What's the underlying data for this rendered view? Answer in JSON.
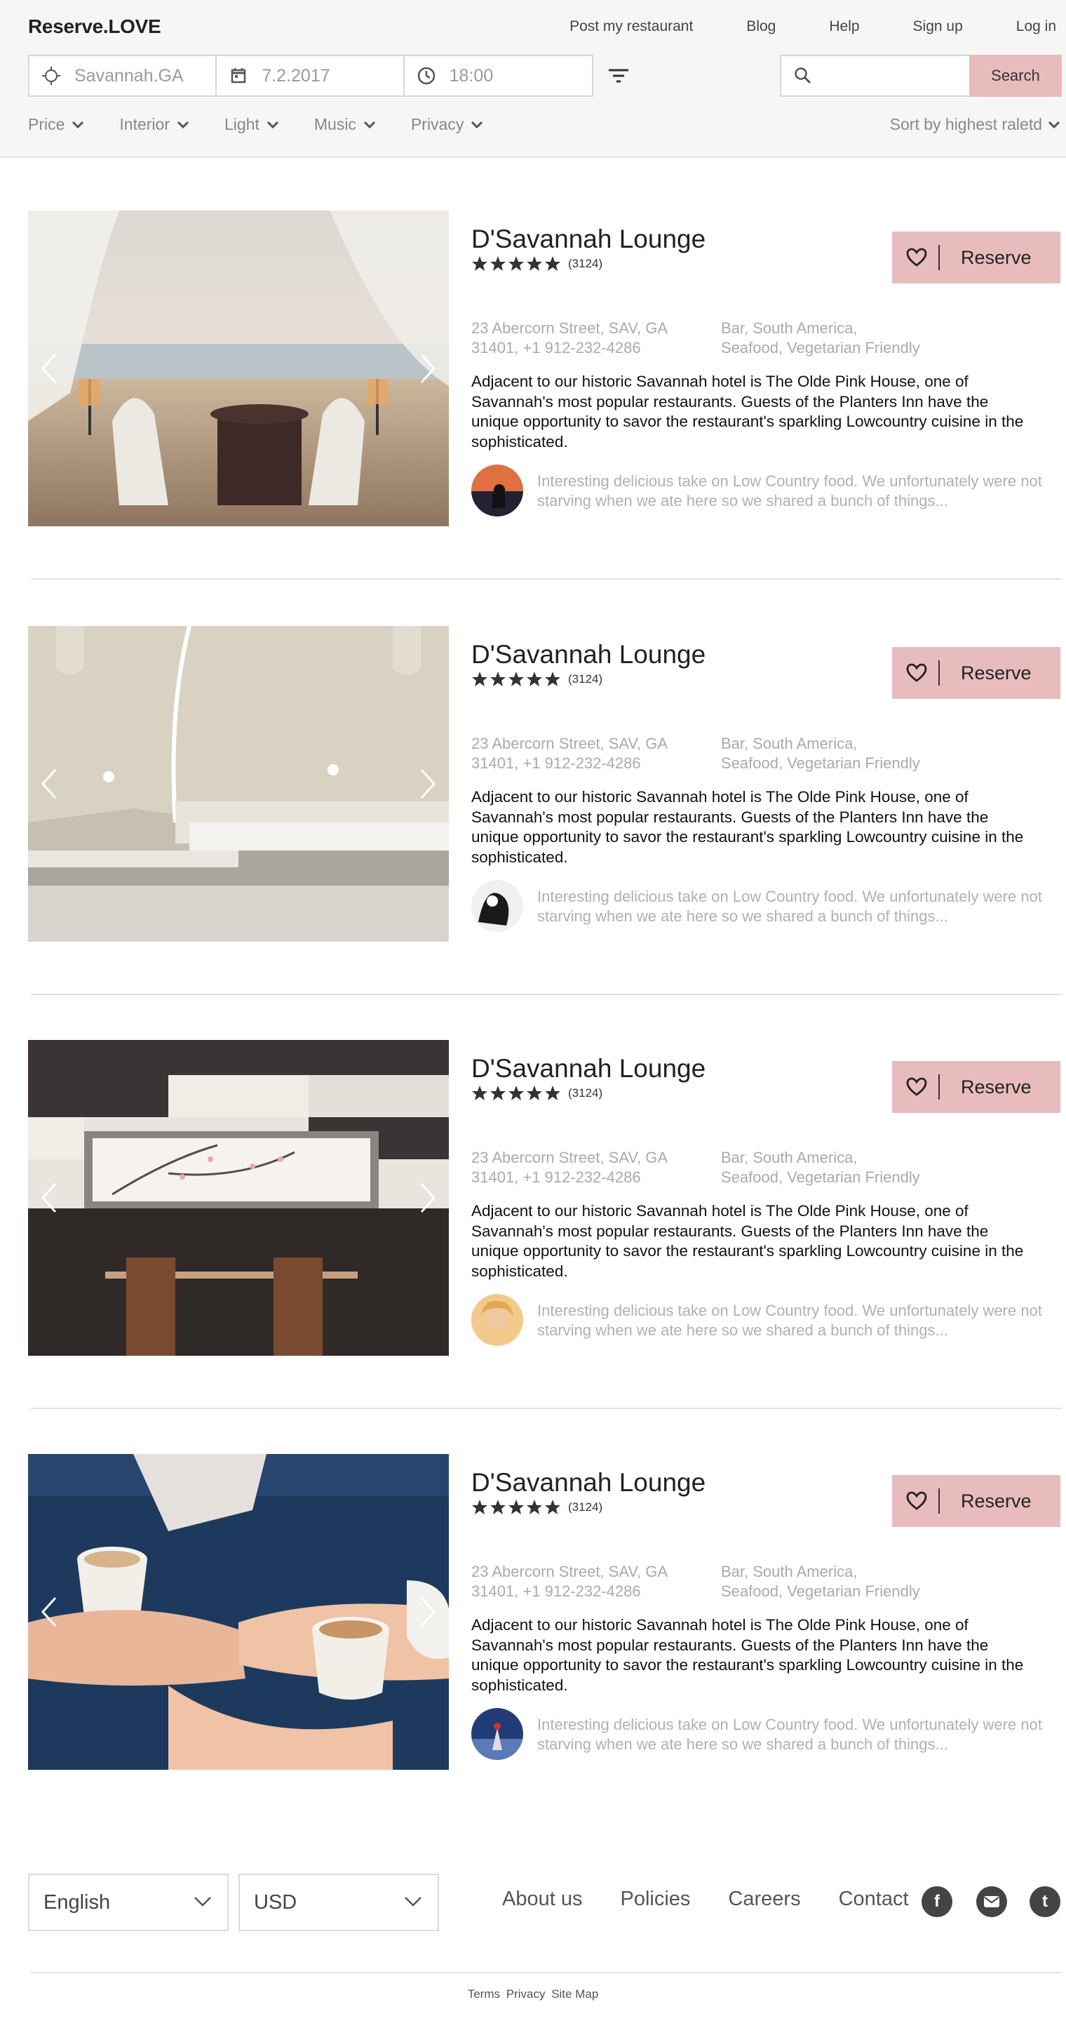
{
  "header": {
    "logo": "Reserve.LOVE",
    "nav": [
      "Post my restaurant",
      "Blog",
      "Help",
      "Sign up",
      "Log in"
    ],
    "location": "Savannah.GA",
    "date": "7.2.2017",
    "time": "18:00",
    "search_placeholder": "",
    "search_button": "Search",
    "filters": [
      "Price",
      "Interior",
      "Light",
      "Music",
      "Privacy"
    ],
    "sort": "Sort by highest raletd"
  },
  "listings": [
    {
      "name": "D'Savannah Lounge",
      "rating": 5,
      "review_count": "(3124)",
      "reserve_label": "Reserve",
      "address_line1": "23 Abercorn Street, SAV, GA",
      "address_line2": "31401, +1 912-232-4286",
      "cuisine_line1": "Bar, South America,",
      "cuisine_line2": "Seafood, Vegetarian Friendly",
      "description": "Adjacent to our historic Savannah hotel is The Olde Pink House, one of Savannah's most popular restaurants. Guests of the Planters Inn have the unique opportunity to savor the restaurant's sparkling Lowcountry cuisine in the sophisticated.",
      "review": "Interesting delicious take on Low Country food. We unfortunately were not starving when we ate here so we shared a bunch of things..."
    },
    {
      "name": "D'Savannah Lounge",
      "rating": 5,
      "review_count": "(3124)",
      "reserve_label": "Reserve",
      "address_line1": "23 Abercorn Street, SAV, GA",
      "address_line2": "31401, +1 912-232-4286",
      "cuisine_line1": "Bar, South America,",
      "cuisine_line2": "Seafood, Vegetarian Friendly",
      "description": "Adjacent to our historic Savannah hotel is The Olde Pink House, one of Savannah's most popular restaurants. Guests of the Planters Inn have the unique opportunity to savor the restaurant's sparkling Lowcountry cuisine in the sophisticated.",
      "review": "Interesting delicious take on Low Country food. We unfortunately were not starving when we ate here so we shared a bunch of things..."
    },
    {
      "name": "D'Savannah Lounge",
      "rating": 5,
      "review_count": "(3124)",
      "reserve_label": "Reserve",
      "address_line1": "23 Abercorn Street, SAV, GA",
      "address_line2": "31401, +1 912-232-4286",
      "cuisine_line1": "Bar, South America,",
      "cuisine_line2": "Seafood, Vegetarian Friendly",
      "description": "Adjacent to our historic Savannah hotel is The Olde Pink House, one of Savannah's most popular restaurants. Guests of the Planters Inn have the unique opportunity to savor the restaurant's sparkling Lowcountry cuisine in the sophisticated.",
      "review": "Interesting delicious take on Low Country food. We unfortunately were not starving when we ate here so we shared a bunch of things..."
    },
    {
      "name": "D'Savannah Lounge",
      "rating": 5,
      "review_count": "(3124)",
      "reserve_label": "Reserve",
      "address_line1": "23 Abercorn Street, SAV, GA",
      "address_line2": "31401, +1 912-232-4286",
      "cuisine_line1": "Bar, South America,",
      "cuisine_line2": "Seafood, Vegetarian Friendly",
      "description": "Adjacent to our historic Savannah hotel is The Olde Pink House, one of Savannah's most popular restaurants. Guests of the Planters Inn have the unique opportunity to savor the restaurant's sparkling Lowcountry cuisine in the sophisticated.",
      "review": "Interesting delicious take on Low Country food. We unfortunately were not starving when we ate here so we shared a bunch of things..."
    }
  ],
  "footer": {
    "language": "English",
    "currency": "USD",
    "links": [
      "About us",
      "Policies",
      "Careers",
      "Contact"
    ],
    "social_icons": [
      "facebook-icon",
      "email-icon",
      "tumblr-icon"
    ],
    "legal": [
      "Terms",
      "Privacy",
      "Site Map"
    ]
  },
  "colors": {
    "accent": "#e8bcbc",
    "header_bg": "#f6f6f6",
    "muted_text": "#aaaaaa",
    "dark_icon": "#444444"
  }
}
